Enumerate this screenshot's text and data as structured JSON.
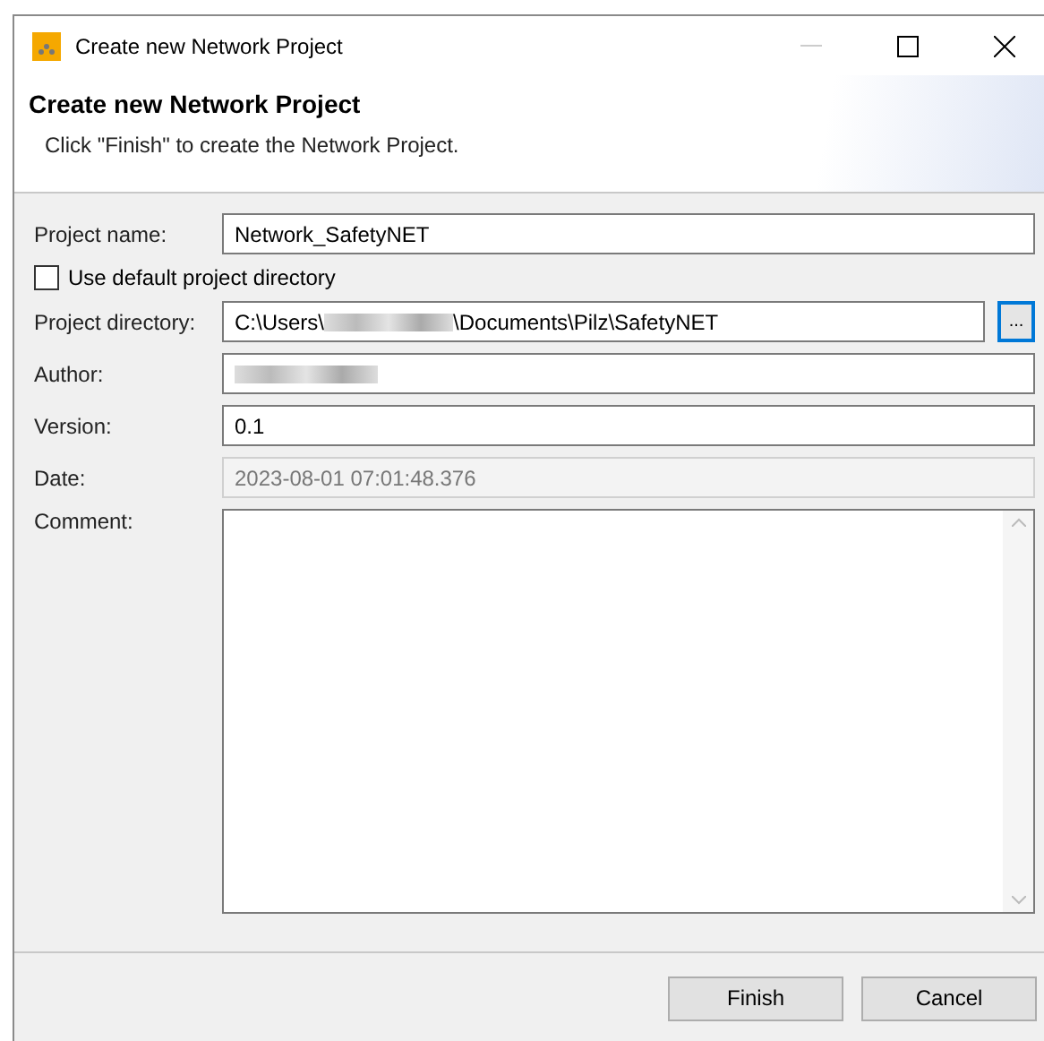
{
  "window": {
    "title": "Create new Network Project"
  },
  "header": {
    "title": "Create new Network Project",
    "message": "Click \"Finish\" to create the Network Project."
  },
  "form": {
    "project_name": {
      "label": "Project name:",
      "value": "Network_SafetyNET"
    },
    "use_default": {
      "label": "Use default project directory",
      "checked": false
    },
    "project_directory": {
      "label": "Project directory:",
      "value_start": "C:\\Users\\",
      "value_end": "\\Documents\\Pilz\\SafetyNET",
      "browse": "..."
    },
    "author": {
      "label": "Author:",
      "redacted": true
    },
    "version": {
      "label": "Version:",
      "value": "0.1"
    },
    "date": {
      "label": "Date:",
      "value": "2023-08-01 07:01:48.376",
      "disabled": true
    },
    "comment": {
      "label": "Comment:"
    }
  },
  "buttons": [
    {
      "label": "Finish"
    },
    {
      "label": "Cancel"
    }
  ]
}
